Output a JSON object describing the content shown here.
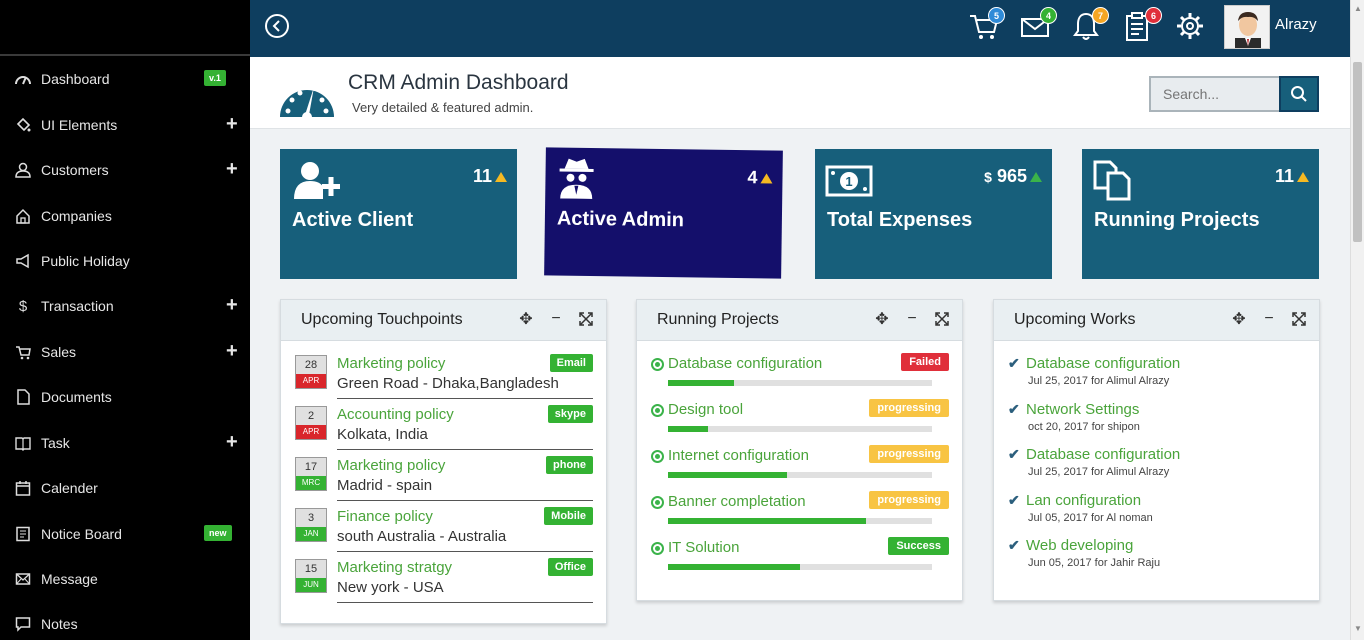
{
  "sidebar": {
    "items": [
      {
        "label": "Dashboard",
        "icon": "dashboard-icon",
        "badge": "v.1",
        "expand": ""
      },
      {
        "label": "UI Elements",
        "icon": "paint-bucket-icon",
        "badge": "",
        "expand": "+"
      },
      {
        "label": "Customers",
        "icon": "user-icon",
        "badge": "",
        "expand": "+"
      },
      {
        "label": "Companies",
        "icon": "home-icon",
        "badge": "",
        "expand": ""
      },
      {
        "label": "Public Holiday",
        "icon": "megaphone-icon",
        "badge": "",
        "expand": ""
      },
      {
        "label": "Transaction",
        "icon": "dollar-icon",
        "badge": "",
        "expand": "+"
      },
      {
        "label": "Sales",
        "icon": "cart-icon",
        "badge": "",
        "expand": "+"
      },
      {
        "label": "Documents",
        "icon": "document-icon",
        "badge": "",
        "expand": ""
      },
      {
        "label": "Task",
        "icon": "book-icon",
        "badge": "",
        "expand": "+"
      },
      {
        "label": "Calender",
        "icon": "calendar-icon",
        "badge": "",
        "expand": ""
      },
      {
        "label": "Notice Board",
        "icon": "clipboard-icon",
        "badge": "new",
        "expand": ""
      },
      {
        "label": "Message",
        "icon": "envelope-icon",
        "badge": "",
        "expand": ""
      },
      {
        "label": "Notes",
        "icon": "note-icon",
        "badge": "",
        "expand": ""
      }
    ]
  },
  "topbar": {
    "cart_count": "5",
    "mail_count": "4",
    "notification_count": "7",
    "task_count": "6",
    "user_name": "Alrazy"
  },
  "header": {
    "title": "CRM Admin Dashboard",
    "subtitle": "Very detailed & featured admin.",
    "search_placeholder": "Search..."
  },
  "stats": [
    {
      "title": "Active Client",
      "value": "11",
      "prefix": "",
      "color": "#175f7b"
    },
    {
      "title": "Active Admin",
      "value": "4",
      "prefix": "",
      "color": "#140f6b"
    },
    {
      "title": "Total Expenses",
      "value": "965",
      "prefix": "$",
      "color": "#175f7b"
    },
    {
      "title": "Running Projects",
      "value": "11",
      "prefix": "",
      "color": "#175f7b"
    }
  ],
  "touchpoints": {
    "title": "Upcoming Touchpoints",
    "items": [
      {
        "day": "28",
        "month": "APR",
        "title": "Marketing policy",
        "subtitle": "Green Road - Dhaka,Bangladesh",
        "tag": "Email",
        "month_color": "#d9262b"
      },
      {
        "day": "2",
        "month": "APR",
        "title": "Accounting policy",
        "subtitle": "Kolkata, India",
        "tag": "skype",
        "month_color": "#d9262b"
      },
      {
        "day": "17",
        "month": "MRC",
        "title": "Marketing policy",
        "subtitle": "Madrid - spain",
        "tag": "phone",
        "month_color": "#34b233"
      },
      {
        "day": "3",
        "month": "JAN",
        "title": "Finance policy",
        "subtitle": "south Australia - Australia",
        "tag": "Mobile",
        "month_color": "#34b233"
      },
      {
        "day": "15",
        "month": "JUN",
        "title": "Marketing stratgy",
        "subtitle": "New york - USA",
        "tag": "Office",
        "month_color": "#34b233"
      }
    ]
  },
  "running_projects": {
    "title": "Running Projects",
    "items": [
      {
        "name": "Database configuration",
        "status": "Failed",
        "status_color": "#e02f3a",
        "progress": 0.25
      },
      {
        "name": "Design tool",
        "status": "progressing",
        "status_color": "#f8c443",
        "progress": 0.15
      },
      {
        "name": "Internet configuration",
        "status": "progressing",
        "status_color": "#f8c443",
        "progress": 0.45
      },
      {
        "name": "Banner completation",
        "status": "progressing",
        "status_color": "#f8c443",
        "progress": 0.75
      },
      {
        "name": "IT Solution",
        "status": "Success",
        "status_color": "#34b233",
        "progress": 0.5
      }
    ]
  },
  "upcoming_works": {
    "title": "Upcoming Works",
    "items": [
      {
        "title": "Database configuration",
        "meta": "Jul 25, 2017 for Alimul Alrazy"
      },
      {
        "title": "Network Settings",
        "meta": "oct 20, 2017 for shipon"
      },
      {
        "title": "Database configuration",
        "meta": "Jul 25, 2017 for Alimul Alrazy"
      },
      {
        "title": "Lan configuration",
        "meta": "Jul 05, 2017 for Al noman"
      },
      {
        "title": "Web developing",
        "meta": "Jun 05, 2017 for Jahir Raju"
      }
    ]
  }
}
